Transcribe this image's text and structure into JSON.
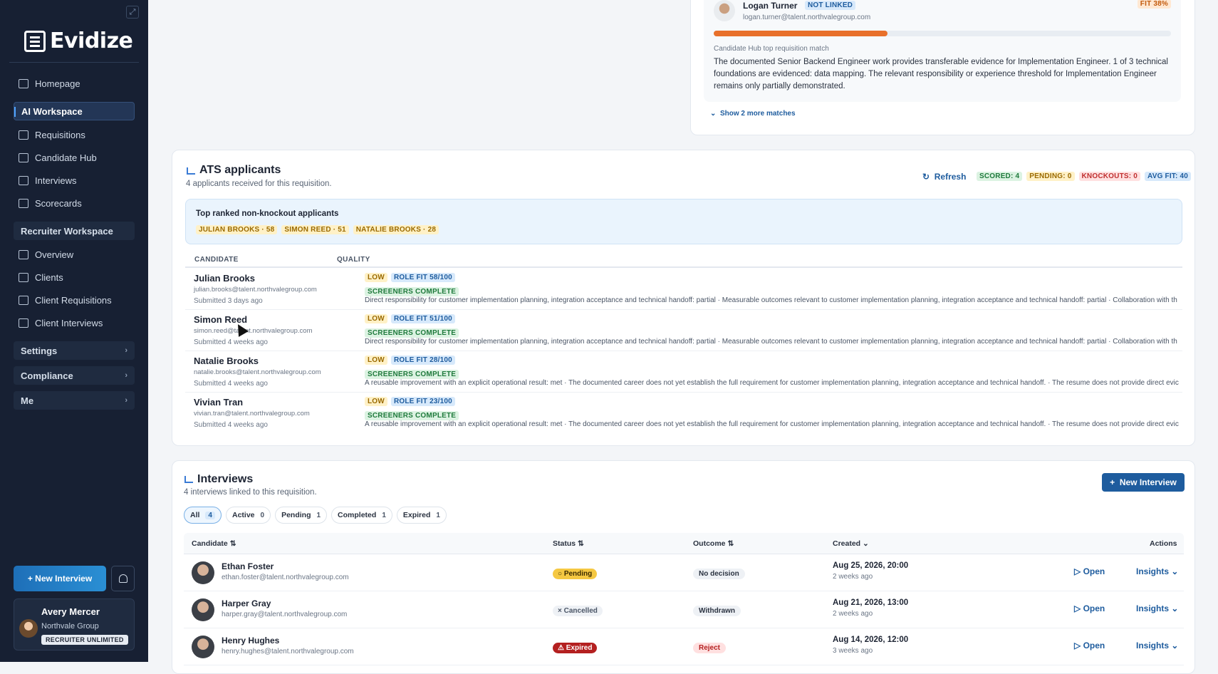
{
  "brand": {
    "name": "Evidize"
  },
  "sidebar": {
    "nav": [
      {
        "label": "Homepage",
        "icon": "home-icon"
      },
      {
        "label": "AI Workspace",
        "active": true
      },
      {
        "label": "Requisitions",
        "icon": "briefcase-icon"
      },
      {
        "label": "Candidate Hub",
        "icon": "scan-user-icon"
      },
      {
        "label": "Interviews",
        "icon": "calendar-icon"
      },
      {
        "label": "Scorecards",
        "icon": "clipboard-icon"
      }
    ],
    "recruiter_group": "Recruiter Workspace",
    "recruiter_nav": [
      {
        "label": "Overview",
        "icon": "grid-icon"
      },
      {
        "label": "Clients",
        "icon": "building-icon"
      },
      {
        "label": "Client Requisitions",
        "icon": "briefcase-icon"
      },
      {
        "label": "Client Interviews",
        "icon": "calendar-icon"
      }
    ],
    "groups": [
      "Settings",
      "Compliance",
      "Me"
    ],
    "new_interview_label": "+ New Interview",
    "user": {
      "name": "Avery Mercer",
      "org": "Northvale Group",
      "plan": "RECRUITER UNLIMITED"
    }
  },
  "top_match": {
    "name": "Logan Turner",
    "link_status": "NOT LINKED",
    "email": "logan.turner@talent.northvalegroup.com",
    "fit": "FIT 38%",
    "fit_value": 38,
    "label": "Candidate Hub top requisition match",
    "text": "The documented Senior Backend Engineer work provides transferable evidence for Implementation Engineer. 1 of 3 technical foundations are evidenced: data mapping. The relevant responsibility or experience threshold for Implementation Engineer remains only partially demonstrated.",
    "more_link": "Show 2 more matches"
  },
  "ats": {
    "title": "ATS applicants",
    "subtitle": "4 applicants received for this requisition.",
    "refresh": "Refresh",
    "stats": [
      {
        "label": "SCORED: 4",
        "color": "#1f7a3c"
      },
      {
        "label": "PENDING: 0",
        "color": "#9a6a00"
      },
      {
        "label": "KNOCKOUTS: 0",
        "color": "#c03030"
      },
      {
        "label": "AVG FIT: 40",
        "color": "#1e5c9e"
      }
    ],
    "top_ranked_title": "Top ranked non-knockout applicants",
    "top_ranked": [
      "JULIAN BROOKS · 58",
      "SIMON REED · 51",
      "NATALIE BROOKS · 28"
    ],
    "columns": [
      "CANDIDATE",
      "QUALITY"
    ],
    "rows": [
      {
        "name": "Julian Brooks",
        "email": "julian.brooks@talent.northvalegroup.com",
        "submitted": "Submitted 3 days ago",
        "level": "LOW",
        "fit": "ROLE FIT 58/100",
        "screeners": "SCREENERS COMPLETE",
        "detail": "Direct responsibility for customer implementation planning, integration acceptance and technical handoff: partial · Measurable outcomes relevant to customer implementation planning, integration acceptance and technical handoff: partial · Collaboration with th"
      },
      {
        "name": "Simon Reed",
        "email": "simon.reed@talent.northvalegroup.com",
        "submitted": "Submitted 4 weeks ago",
        "level": "LOW",
        "fit": "ROLE FIT 51/100",
        "screeners": "SCREENERS COMPLETE",
        "detail": "Direct responsibility for customer implementation planning, integration acceptance and technical handoff: partial · Measurable outcomes relevant to customer implementation planning, integration acceptance and technical handoff: partial · Collaboration with th"
      },
      {
        "name": "Natalie Brooks",
        "email": "natalie.brooks@talent.northvalegroup.com",
        "submitted": "Submitted 4 weeks ago",
        "level": "LOW",
        "fit": "ROLE FIT 28/100",
        "screeners": "SCREENERS COMPLETE",
        "detail": "A reusable improvement with an explicit operational result: met · The documented career does not yet establish the full requirement for customer implementation planning, integration acceptance and technical handoff. · The resume does not provide direct evic"
      },
      {
        "name": "Vivian Tran",
        "email": "vivian.tran@talent.northvalegroup.com",
        "submitted": "Submitted 4 weeks ago",
        "level": "LOW",
        "fit": "ROLE FIT 23/100",
        "screeners": "SCREENERS COMPLETE",
        "detail": "A reusable improvement with an explicit operational result: met · The documented career does not yet establish the full requirement for customer implementation planning, integration acceptance and technical handoff. · The resume does not provide direct evic"
      }
    ]
  },
  "interviews": {
    "title": "Interviews",
    "subtitle": "4 interviews linked to this requisition.",
    "new_button": "New Interview",
    "filters": [
      {
        "label": "All",
        "count": "4",
        "active": true
      },
      {
        "label": "Active",
        "count": "0"
      },
      {
        "label": "Pending",
        "count": "1"
      },
      {
        "label": "Completed",
        "count": "1"
      },
      {
        "label": "Expired",
        "count": "1"
      }
    ],
    "columns": {
      "candidate": "Candidate",
      "status": "Status",
      "outcome": "Outcome",
      "created": "Created",
      "actions": "Actions"
    },
    "rows": [
      {
        "name": "Ethan Foster",
        "email": "ethan.foster@talent.northvalegroup.com",
        "status": "Pending",
        "outcome": "No decision",
        "date": "Aug 25, 2026, 20:00",
        "ago": "2 weeks ago",
        "open": "Open",
        "insights": "Insights"
      },
      {
        "name": "Harper Gray",
        "email": "harper.gray@talent.northvalegroup.com",
        "status": "Cancelled",
        "outcome": "Withdrawn",
        "date": "Aug 21, 2026, 13:00",
        "ago": "2 weeks ago",
        "open": "Open",
        "insights": "Insights"
      },
      {
        "name": "Henry Hughes",
        "email": "henry.hughes@talent.northvalegroup.com",
        "status": "Expired",
        "outcome": "Reject",
        "date": "Aug 14, 2026, 12:00",
        "ago": "3 weeks ago",
        "open": "Open",
        "insights": "Insights"
      }
    ]
  }
}
